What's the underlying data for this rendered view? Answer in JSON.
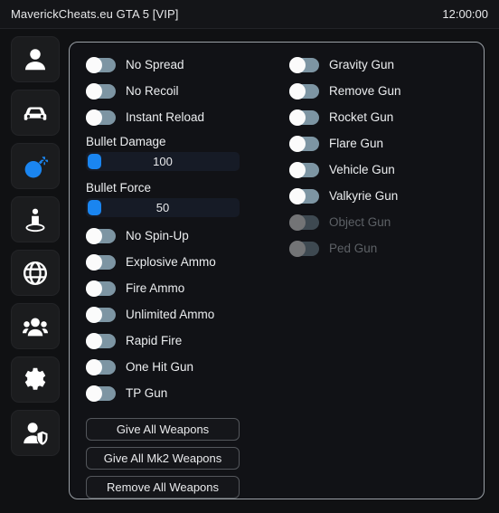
{
  "titlebar": {
    "title": "MaverickCheats.eu GTA 5 [VIP]",
    "clock": "12:00:00"
  },
  "sidebar": {
    "items": [
      {
        "icon": "person-icon",
        "name": "sidebar-item-player",
        "active": false
      },
      {
        "icon": "car-icon",
        "name": "sidebar-item-vehicle",
        "active": false
      },
      {
        "icon": "bomb-icon",
        "name": "sidebar-item-weapons",
        "active": true
      },
      {
        "icon": "teleport-icon",
        "name": "sidebar-item-teleport",
        "active": false
      },
      {
        "icon": "globe-icon",
        "name": "sidebar-item-world",
        "active": false
      },
      {
        "icon": "group-icon",
        "name": "sidebar-item-online",
        "active": false
      },
      {
        "icon": "gear-icon",
        "name": "sidebar-item-settings",
        "active": false
      },
      {
        "icon": "person-shield-icon",
        "name": "sidebar-item-protections",
        "active": false
      }
    ]
  },
  "panel": {
    "left_column": {
      "toggles_top": [
        {
          "label": "No Spread",
          "on": false,
          "disabled": false
        },
        {
          "label": "No Recoil",
          "on": false,
          "disabled": false
        },
        {
          "label": "Instant Reload",
          "on": false,
          "disabled": false
        }
      ],
      "sliders": [
        {
          "label": "Bullet Damage",
          "value": "100"
        },
        {
          "label": "Bullet Force",
          "value": "50"
        }
      ],
      "toggles_bottom": [
        {
          "label": "No Spin-Up",
          "on": false,
          "disabled": false
        },
        {
          "label": "Explosive Ammo",
          "on": false,
          "disabled": false
        },
        {
          "label": "Fire Ammo",
          "on": false,
          "disabled": false
        },
        {
          "label": "Unlimited Ammo",
          "on": false,
          "disabled": false
        },
        {
          "label": "Rapid Fire",
          "on": false,
          "disabled": false
        },
        {
          "label": "One Hit Gun",
          "on": false,
          "disabled": false
        },
        {
          "label": "TP Gun",
          "on": false,
          "disabled": false
        }
      ],
      "buttons": [
        {
          "label": "Give All Weapons",
          "name": "give-all-weapons-button"
        },
        {
          "label": "Give All Mk2 Weapons",
          "name": "give-all-mk2-weapons-button"
        },
        {
          "label": "Remove All Weapons",
          "name": "remove-all-weapons-button"
        }
      ]
    },
    "right_column": {
      "toggles": [
        {
          "label": "Gravity Gun",
          "on": false,
          "disabled": false
        },
        {
          "label": "Remove Gun",
          "on": false,
          "disabled": false
        },
        {
          "label": "Rocket Gun",
          "on": false,
          "disabled": false
        },
        {
          "label": "Flare Gun",
          "on": false,
          "disabled": false
        },
        {
          "label": "Vehicle Gun",
          "on": false,
          "disabled": false
        },
        {
          "label": "Valkyrie Gun",
          "on": false,
          "disabled": false
        },
        {
          "label": "Object Gun",
          "on": false,
          "disabled": true
        },
        {
          "label": "Ped Gun",
          "on": false,
          "disabled": true
        }
      ]
    }
  },
  "colors": {
    "accent": "#1a85f0",
    "toggle_track": "#7d95a3",
    "panel_border": "#9aa0a6",
    "background": "#101113"
  }
}
